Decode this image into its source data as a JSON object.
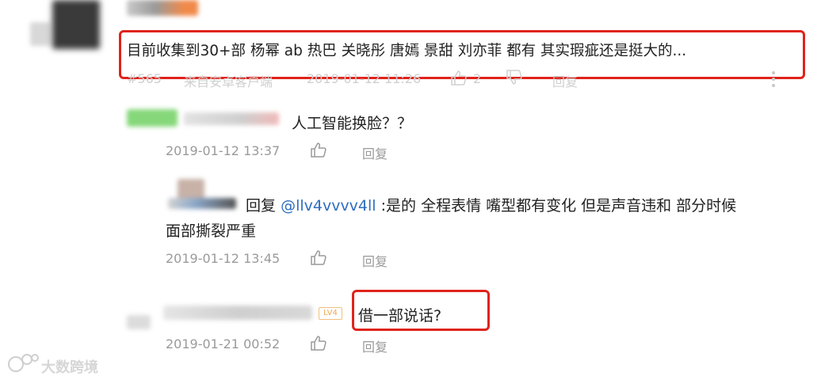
{
  "comments": [
    {
      "text": "目前收集到30+部 杨幂 ab 热巴 关晓彤 唐嫣 景甜 刘亦菲 都有 其实瑕疵还是挺大的...",
      "floor": "#565",
      "source": "来自安卓客户端",
      "time": "2019-01-12 11:26",
      "likes": "2",
      "reply": "回复"
    },
    {
      "username": "lvvvv4ll",
      "text": "人工智能换脸？？",
      "time": "2019-01-12 13:37",
      "reply": "回复"
    },
    {
      "reply_word": "回复",
      "mention": "@llv4vvvv4ll",
      "text_line1": ":是的 全程表情 嘴型都有变化 但是声音违和 部分时候",
      "text_line2": "面部撕裂严重",
      "time": "2019-01-12 13:45",
      "reply": "回复"
    },
    {
      "badge": "LV4",
      "text": "借一部说话?",
      "time": "2019-01-21 00:52",
      "reply": "回复"
    }
  ],
  "watermark": "大数跨境",
  "colors": {
    "highlight": "#e0231b",
    "mention_link": "#2f6ec0",
    "meta_text": "#9a9a9a",
    "body_text": "#222222"
  },
  "icons": [
    "thumbs-up-icon",
    "thumbs-down-icon",
    "more-vertical-icon",
    "watermark-logo-icon"
  ]
}
